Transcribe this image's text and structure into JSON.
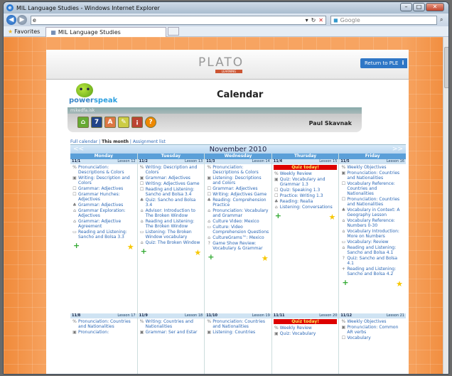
{
  "window": {
    "title": "MIL Language Studies - Windows Internet Explorer"
  },
  "address": {
    "value": "e",
    "search_placeholder": "Google"
  },
  "favorites": {
    "label": "Favorites",
    "tab": "MIL Language Studies"
  },
  "header": {
    "brand": "PLATO",
    "brand_sub": "LEARNING",
    "return_label": "Return to PLE",
    "info": "i"
  },
  "app": {
    "logo_text_1": "power",
    "logo_text_2": "speak",
    "title": "Calendar",
    "user_id": "mikedfa.isk",
    "user_name": "Paul Skavnak"
  },
  "links": {
    "full": "Full calendar",
    "month": "This month",
    "assign": "Assignment list"
  },
  "calendar": {
    "month": "November 2010",
    "prev": "<<",
    "next": ">>",
    "days": [
      {
        "name": "Monday",
        "date": "11/1",
        "lesson": "Lesson 12",
        "quiz": "",
        "items": [
          "Pronunciation: Descriptions & Colors",
          "Writing: Description and Colors",
          "Grammar: Adjectives",
          "Grammar Hunches: Adjectives",
          "Grammar: Adjectives",
          "Grammar Exploration: Adjectives",
          "Grammar: Adjective Agreement",
          "Reading and Listening: Sancho and Bolsa 3.3"
        ]
      },
      {
        "name": "Tuesday",
        "date": "11/2",
        "lesson": "Lesson 13",
        "quiz": "",
        "items": [
          "Writing: Description and Colors",
          "Grammar: Adjectives",
          "Writing: Adjectives Game",
          "Reading and Listening: Sancho and Bolsa 3.4",
          "Quiz: Sancho and Bolsa 3.4",
          "Advisor: Introduction to The Broken Window",
          "Reading and Listening: The Broken Window",
          "Listening: The Broken Window vocabulary",
          "Quiz: The Broken Window"
        ]
      },
      {
        "name": "Wednesday",
        "date": "11/3",
        "lesson": "Lesson 14",
        "quiz": "",
        "items": [
          "Pronunciation: Descriptions & Colors",
          "Listening: Descriptions and Colors",
          "Grammar: Adjectives",
          "Writing: Adjectives Game",
          "Reading: Comprehension Practice",
          "Pronunciation: Vocabulary and Grammar",
          "Culture Video: Mexico",
          "Culture: Video Comprehension Questions",
          "CultureGrams™: Mexico",
          "Game Show Review: Vocabulary & Grammar"
        ]
      },
      {
        "name": "Thursday",
        "date": "11/4",
        "lesson": "Lesson 15",
        "quiz": "Quiz today!",
        "items": [
          "Weekly Review",
          "Quiz: Vocabulary and Grammar 1.3",
          "Quiz: Speaking 1.3",
          "Practice: Writing 1.3",
          "Reading: Realia",
          "Listening: Conversations"
        ]
      },
      {
        "name": "Friday",
        "date": "11/5",
        "lesson": "Lesson 16",
        "quiz": "",
        "items": [
          "Weekly Objectives",
          "Pronunciation: Countries and Nationalities",
          "Vocabulary Reference: Countries and Nationalities",
          "Pronunciation: Countries and Nationalities",
          "Vocabulary in Context: A Geography Lesson",
          "Vocabulary Reference: Numbers 0-30",
          "Vocabulary Introduction: More on Numbers",
          "Vocabulary: Review",
          "Reading and Listening: Sancho and Bolsa 4.1",
          "Quiz: Sancho and Bolsa 4.1",
          "Reading and Listening: Sancho and Bolsa 4.2"
        ]
      }
    ],
    "week2": [
      {
        "date": "11/8",
        "lesson": "Lesson 17",
        "quiz": "",
        "items": [
          "Pronunciation: Countries and Nationalities",
          "Pronunciation:"
        ]
      },
      {
        "date": "11/9",
        "lesson": "Lesson 18",
        "quiz": "",
        "items": [
          "Writing: Countries and Nationalities",
          "Grammar: Ser and Estar"
        ]
      },
      {
        "date": "11/10",
        "lesson": "Lesson 19",
        "quiz": "",
        "items": [
          "Pronunciation: Countries and Nationalities",
          "Listening: Countries"
        ]
      },
      {
        "date": "11/11",
        "lesson": "Lesson 20",
        "quiz": "Quiz today!",
        "items": [
          "Weekly Review",
          "Quiz: Vocabulary"
        ]
      },
      {
        "date": "11/12",
        "lesson": "Lesson 21",
        "quiz": "",
        "items": [
          "Weekly Objectives",
          "Pronunciation: Common AR verbs",
          "Vocabulary"
        ]
      }
    ]
  }
}
